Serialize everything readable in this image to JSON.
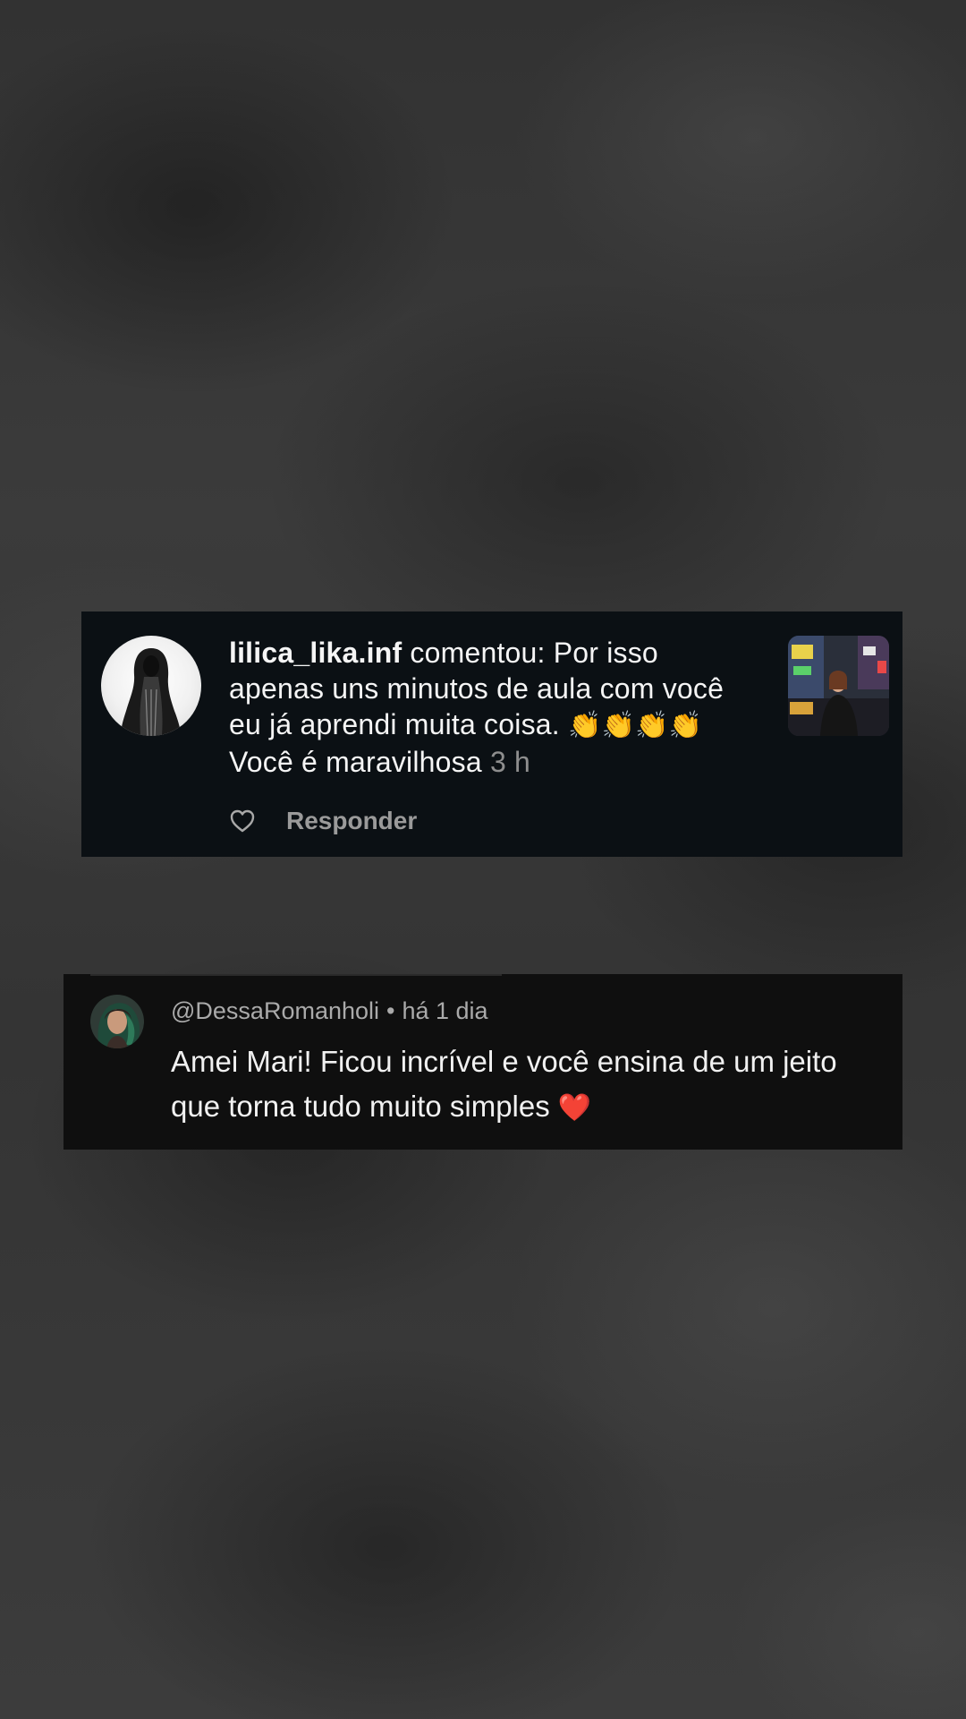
{
  "instagram_comment": {
    "username": "lilica_lika.inf",
    "action_text": " comentou: ",
    "comment_line1": "Por isso apenas uns minutos de aula com você eu já aprendi muita coisa. ",
    "emojis": "👏👏👏👏",
    "comment_line2": " Você é maravilhosa ",
    "time": "3 h",
    "reply_label": "Responder",
    "avatar_icon": "profile-avatar-icon",
    "thumbnail_icon": "post-thumbnail-icon",
    "like_icon": "heart-outline-icon"
  },
  "youtube_comment": {
    "author": "@DessaRomanholi",
    "separator": "•",
    "time": "há 1 dia",
    "text": "Amei Mari! Ficou incrível e você ensina de um jeito que torna tudo muito simples ",
    "emoji": "❤️",
    "avatar_icon": "profile-avatar-icon"
  },
  "colors": {
    "background": "#3a3a3a",
    "ig_card": "#0b1014",
    "yt_card": "#0f0f0f",
    "muted_text": "#8e8e8e"
  }
}
